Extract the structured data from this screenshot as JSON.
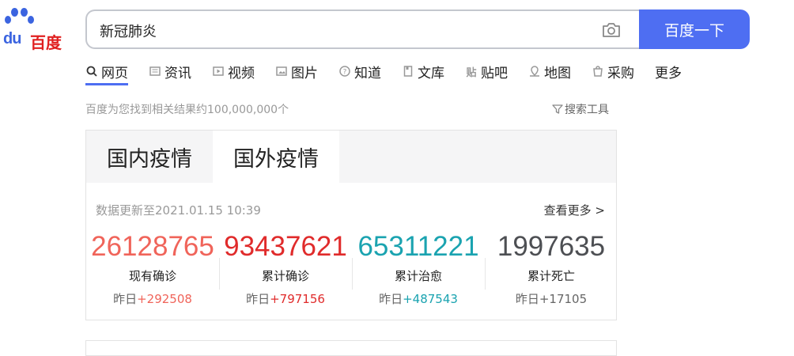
{
  "logo": {
    "du": "du",
    "name": "百度"
  },
  "search": {
    "query": "新冠肺炎",
    "button_label": "百度一下"
  },
  "tabs": [
    {
      "label": "网页",
      "icon": "search-icon"
    },
    {
      "label": "资讯",
      "icon": "news-icon"
    },
    {
      "label": "视频",
      "icon": "video-icon"
    },
    {
      "label": "图片",
      "icon": "image-icon"
    },
    {
      "label": "知道",
      "icon": "question-icon"
    },
    {
      "label": "文库",
      "icon": "doc-icon"
    },
    {
      "label": "贴吧",
      "icon": "tieba-icon"
    },
    {
      "label": "地图",
      "icon": "map-icon"
    },
    {
      "label": "采购",
      "icon": "cart-icon"
    },
    {
      "label": "更多",
      "icon": ""
    }
  ],
  "result_count": "百度为您找到相关结果约100,000,000个",
  "tools_label": "搜索工具",
  "card": {
    "tabs": [
      "国内疫情",
      "国外疫情"
    ],
    "selected_tab": 1,
    "update_text": "数据更新至2021.01.15 10:39",
    "more_text": "查看更多 >",
    "yesterday_prefix": "昨日",
    "stats": [
      {
        "number": "26128765",
        "label": "现有确诊",
        "delta": "+292508",
        "color": "#f0645a"
      },
      {
        "number": "93437621",
        "label": "累计确诊",
        "delta": "+797156",
        "color": "#e02b2b"
      },
      {
        "number": "65311221",
        "label": "累计治愈",
        "delta": "+487543",
        "color": "#1aa3b0"
      },
      {
        "number": "1997635",
        "label": "累计死亡",
        "delta": "+17105",
        "color": "#4d4f53"
      }
    ]
  },
  "colors": {
    "accent": "#4e6ef2",
    "logo_blue": "#3b64e0",
    "logo_red": "#e02020"
  }
}
